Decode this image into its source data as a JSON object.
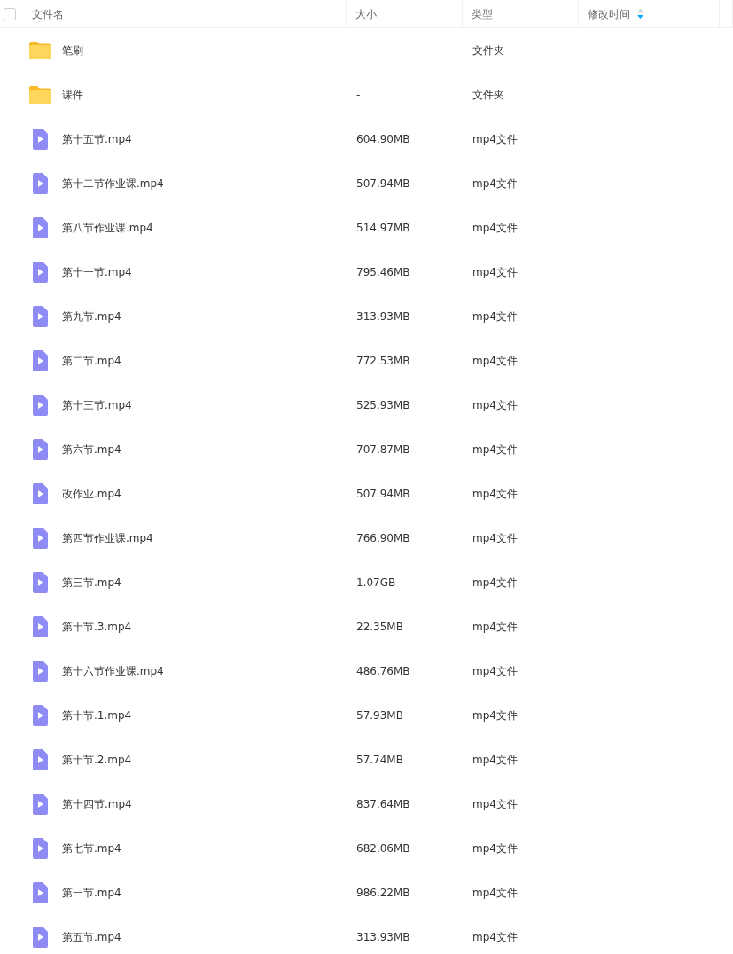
{
  "header": {
    "select_all": {
      "checked": false
    },
    "columns": [
      {
        "label": "文件名",
        "sorted": false
      },
      {
        "label": "大小",
        "sorted": false
      },
      {
        "label": "类型",
        "sorted": false
      },
      {
        "label": "修改时间",
        "sorted": true
      }
    ]
  },
  "rows": [
    {
      "kind": "folder",
      "name": "笔刷",
      "size": "-",
      "type": "文件夹"
    },
    {
      "kind": "folder",
      "name": "课件",
      "size": "-",
      "type": "文件夹"
    },
    {
      "kind": "video",
      "name": "第十五节.mp4",
      "size": "604.90MB",
      "type": "mp4文件"
    },
    {
      "kind": "video",
      "name": "第十二节作业课.mp4",
      "size": "507.94MB",
      "type": "mp4文件"
    },
    {
      "kind": "video",
      "name": "第八节作业课.mp4",
      "size": "514.97MB",
      "type": "mp4文件"
    },
    {
      "kind": "video",
      "name": "第十一节.mp4",
      "size": "795.46MB",
      "type": "mp4文件"
    },
    {
      "kind": "video",
      "name": "第九节.mp4",
      "size": "313.93MB",
      "type": "mp4文件"
    },
    {
      "kind": "video",
      "name": "第二节.mp4",
      "size": "772.53MB",
      "type": "mp4文件"
    },
    {
      "kind": "video",
      "name": "第十三节.mp4",
      "size": "525.93MB",
      "type": "mp4文件"
    },
    {
      "kind": "video",
      "name": "第六节.mp4",
      "size": "707.87MB",
      "type": "mp4文件"
    },
    {
      "kind": "video",
      "name": "改作业.mp4",
      "size": "507.94MB",
      "type": "mp4文件"
    },
    {
      "kind": "video",
      "name": "第四节作业课.mp4",
      "size": "766.90MB",
      "type": "mp4文件"
    },
    {
      "kind": "video",
      "name": "第三节.mp4",
      "size": "1.07GB",
      "type": "mp4文件"
    },
    {
      "kind": "video",
      "name": "第十节.3.mp4",
      "size": "22.35MB",
      "type": "mp4文件"
    },
    {
      "kind": "video",
      "name": "第十六节作业课.mp4",
      "size": "486.76MB",
      "type": "mp4文件"
    },
    {
      "kind": "video",
      "name": "第十节.1.mp4",
      "size": "57.93MB",
      "type": "mp4文件"
    },
    {
      "kind": "video",
      "name": "第十节.2.mp4",
      "size": "57.74MB",
      "type": "mp4文件"
    },
    {
      "kind": "video",
      "name": "第十四节.mp4",
      "size": "837.64MB",
      "type": "mp4文件"
    },
    {
      "kind": "video",
      "name": "第七节.mp4",
      "size": "682.06MB",
      "type": "mp4文件"
    },
    {
      "kind": "video",
      "name": "第一节.mp4",
      "size": "986.22MB",
      "type": "mp4文件"
    },
    {
      "kind": "video",
      "name": "第五节.mp4",
      "size": "313.93MB",
      "type": "mp4文件"
    }
  ]
}
